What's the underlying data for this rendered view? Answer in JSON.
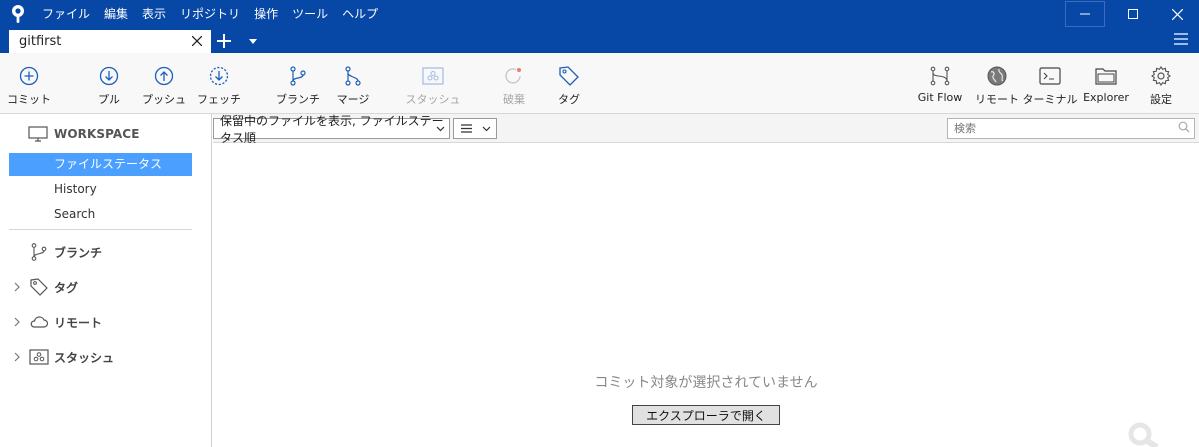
{
  "menu": [
    "ファイル",
    "編集",
    "表示",
    "リポジトリ",
    "操作",
    "ツール",
    "ヘルプ"
  ],
  "tab": {
    "title": "gitfirst"
  },
  "toolbar": {
    "commit": "コミット",
    "pull": "プル",
    "push": "プッシュ",
    "fetch": "フェッチ",
    "branch": "ブランチ",
    "merge": "マージ",
    "stash": "スタッシュ",
    "discard": "破棄",
    "tag": "タグ",
    "gitflow": "Git Flow",
    "remote": "リモート",
    "terminal": "ターミナル",
    "explorer": "Explorer",
    "settings": "設定"
  },
  "sidebar": {
    "workspace": "WORKSPACE",
    "items": [
      "ファイルステータス",
      "History",
      "Search"
    ],
    "groups": {
      "branches": "ブランチ",
      "tags": "タグ",
      "remotes": "リモート",
      "stashes": "スタッシュ"
    }
  },
  "filter": {
    "file_filter": "保留中のファイルを表示, ファイルステータス順",
    "search_placeholder": "検索"
  },
  "main": {
    "empty_message": "コミット対象が選択されていません",
    "open_explorer": "エクスプローラで開く"
  },
  "colors": {
    "title_bar": "#0747a6",
    "selected": "#4a9fff",
    "icon_blue": "#1d5fb8"
  }
}
